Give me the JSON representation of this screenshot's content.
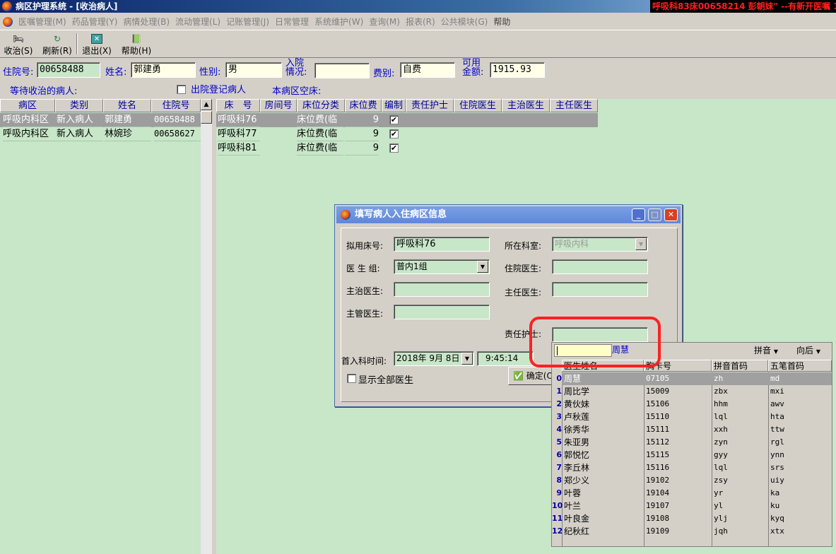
{
  "window": {
    "title": "病区护理系统 - [收治病人]",
    "ticker": "呼吸科83床00658214 彭朝妹\" --有新开医嘱 15:5"
  },
  "menu": {
    "items": [
      {
        "label": "医嘱管理(M)"
      },
      {
        "label": "药品管理(Y)"
      },
      {
        "label": "病情处理(B)"
      },
      {
        "label": "流动管理(L)"
      },
      {
        "label": "记账管理(J)"
      },
      {
        "label": "日常管理"
      },
      {
        "label": "系统维护(W)"
      },
      {
        "label": "查询(M)"
      },
      {
        "label": "报表(R)"
      },
      {
        "label": "公共模块(G)"
      },
      {
        "label": "帮助"
      }
    ]
  },
  "toolbar": {
    "admit_label": "收治(S)",
    "refresh_label": "刷新(R)",
    "exit_label": "退出(X)",
    "help_label": "帮助(H)"
  },
  "form": {
    "inpatient_no_label": "住院号:",
    "inpatient_no": "00658488",
    "name_label": "姓名:",
    "name": "郭建勇",
    "sex_label": "性别:",
    "sex": "男",
    "admission_label_1": "入院",
    "admission_label_2": "情况:",
    "admission": "",
    "fee_label": "费别:",
    "fee": "自费",
    "balance_label_1": "可用",
    "balance_label_2": "金额:",
    "balance": "1915.93",
    "waiting_label": "等待收治的病人:",
    "discharged_label": "出院登记病人",
    "empty_beds_label": "本病区空床:"
  },
  "patients": {
    "headers": [
      "病区",
      "类别",
      "姓名",
      "住院号"
    ],
    "rows": [
      {
        "ward": "呼吸内科区",
        "type": "新入病人",
        "name": "郭建勇",
        "no": "00658488"
      },
      {
        "ward": "呼吸内科区",
        "type": "新入病人",
        "name": "林婉珍",
        "no": "00658627"
      }
    ]
  },
  "beds": {
    "headers": [
      "床　号",
      "房间号",
      "床位分类",
      "床位费",
      "编制",
      "责任护士",
      "住院医生",
      "主治医生",
      "主任医生"
    ],
    "rows": [
      {
        "bed": "呼吸科76",
        "room": "",
        "category": "床位费(临",
        "fee": "9",
        "staffed": true
      },
      {
        "bed": "呼吸科77",
        "room": "",
        "category": "床位费(临",
        "fee": "9",
        "staffed": true
      },
      {
        "bed": "呼吸科81",
        "room": "",
        "category": "床位费(临",
        "fee": "9",
        "staffed": true
      }
    ]
  },
  "dialog": {
    "title": "填写病人入住病区信息",
    "bed_label": "拟用床号:",
    "bed": "呼吸科76",
    "dept_label": "所在科室:",
    "dept": "呼吸内科",
    "group_label": "医 生 组:",
    "group": "普内1组",
    "resident_label": "住院医生:",
    "resident": "",
    "attending_label": "主治医生:",
    "attending": "",
    "chief_label": "主任医生:",
    "chief": "",
    "supervisor_label": "主管医生:",
    "supervisor": "",
    "nurse_label": "责任护士:",
    "nurse": "",
    "time_label": "首入科时间:",
    "date": "2018年 9月 8日",
    "time": "9:45:14",
    "show_all_label": "显示全部医生",
    "ok_label": "确定(O)"
  },
  "popup": {
    "search": "",
    "match": "周慧",
    "opt1": "拼音",
    "opt2": "向后",
    "headers": [
      "医生姓名",
      "胸卡号",
      "拼音首码",
      "五笔首码"
    ],
    "rows": [
      {
        "n": "0",
        "name": "周慧",
        "card": "07105",
        "py": "zh",
        "wb": "md"
      },
      {
        "n": "1",
        "name": "周比学",
        "card": "15009",
        "py": "zbx",
        "wb": "mxi"
      },
      {
        "n": "2",
        "name": "黄伙妹",
        "card": "15106",
        "py": "hhm",
        "wb": "awv"
      },
      {
        "n": "3",
        "name": "卢秋莲",
        "card": "15110",
        "py": "lql",
        "wb": "hta"
      },
      {
        "n": "4",
        "name": "徐秀华",
        "card": "15111",
        "py": "xxh",
        "wb": "ttw"
      },
      {
        "n": "5",
        "name": "朱亚男",
        "card": "15112",
        "py": "zyn",
        "wb": "rgl"
      },
      {
        "n": "6",
        "name": "郭悦忆",
        "card": "15115",
        "py": "gyy",
        "wb": "ynn"
      },
      {
        "n": "7",
        "name": "李丘林",
        "card": "15116",
        "py": "lql",
        "wb": "srs"
      },
      {
        "n": "8",
        "name": "郑少义",
        "card": "19102",
        "py": "zsy",
        "wb": "uiy"
      },
      {
        "n": "9",
        "name": "叶蓉",
        "card": "19104",
        "py": "yr",
        "wb": "ka"
      },
      {
        "n": "10",
        "name": "叶兰",
        "card": "19107",
        "py": "yl",
        "wb": "ku"
      },
      {
        "n": "11",
        "name": "叶良金",
        "card": "19108",
        "py": "ylj",
        "wb": "kyq"
      },
      {
        "n": "12",
        "name": "纪秋红",
        "card": "19109",
        "py": "jqh",
        "wb": "xtx"
      }
    ]
  }
}
